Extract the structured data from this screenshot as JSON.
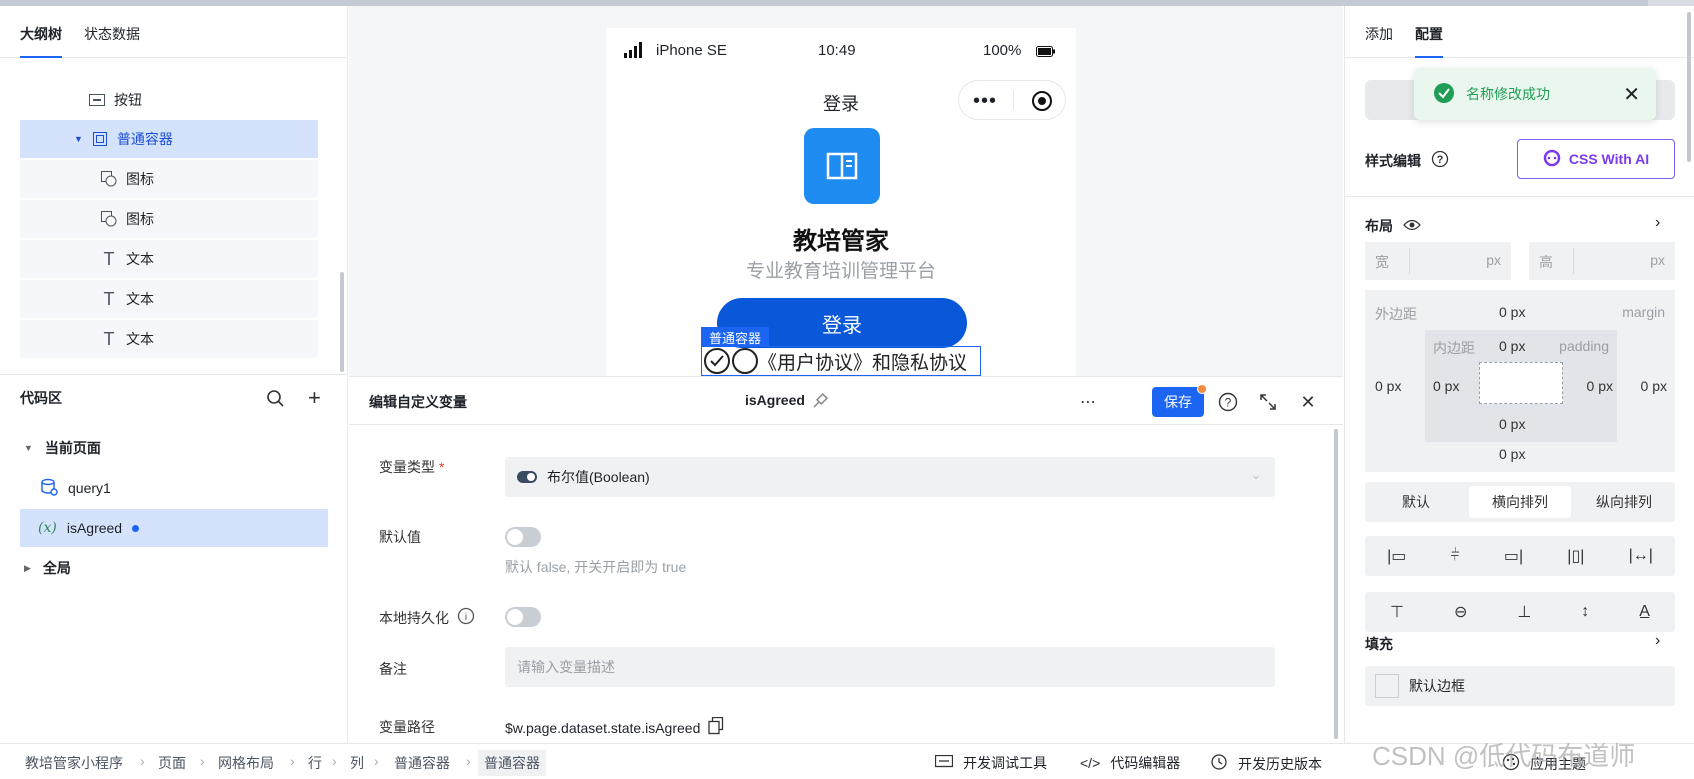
{
  "left_panel": {
    "tabs": [
      "大纲树",
      "状态数据"
    ],
    "tree": [
      {
        "label": "按钮",
        "icon": "button-icon"
      },
      {
        "label": "普通容器",
        "icon": "container-icon"
      },
      {
        "label": "图标",
        "icon": "icon-component-icon"
      },
      {
        "label": "图标",
        "icon": "icon-component-icon"
      },
      {
        "label": "文本",
        "icon": "text-icon"
      },
      {
        "label": "文本",
        "icon": "text-icon"
      },
      {
        "label": "文本",
        "icon": "text-icon"
      }
    ],
    "code_area": {
      "title": "代码区",
      "current_page": "当前页面",
      "items": [
        "query1",
        "isAgreed"
      ],
      "global": "全局"
    }
  },
  "preview": {
    "status_bar": {
      "device": "iPhone SE",
      "time": "10:49",
      "battery": "100%"
    },
    "nav_title": "登录",
    "app_name": "教培管家",
    "app_subtitle": "专业教育培训管理平台",
    "login_button": "登录",
    "selection_tag": "普通容器",
    "agreement_text": "《用户协议》和隐私协议"
  },
  "editor": {
    "title": "编辑自定义变量",
    "variable_name": "isAgreed",
    "save_label": "保存",
    "fields": {
      "type_label": "变量类型",
      "type_value": "布尔值(Boolean)",
      "default_label": "默认值",
      "default_hint": "默认 false, 开关开启即为 true",
      "persist_label": "本地持久化",
      "note_label": "备注",
      "note_placeholder": "请输入变量描述",
      "path_label": "变量路径",
      "path_value": "$w.page.dataset.state.isAgreed"
    }
  },
  "right_panel": {
    "tabs": [
      "添加",
      "配置"
    ],
    "style_edit": "样式编辑",
    "ai_button": "CSS With AI",
    "layout": "布局",
    "width_label": "宽",
    "height_label": "高",
    "unit": "px",
    "margin_label": "外边距",
    "margin_en": "margin",
    "padding_label": "内边距",
    "padding_en": "padding",
    "zero_px": "0 px",
    "direction_options": [
      "默认",
      "横向排列",
      "纵向排列"
    ],
    "fill": "填充",
    "default_border": "默认边框"
  },
  "toast": {
    "message": "名称修改成功"
  },
  "footer": {
    "breadcrumb": [
      "教培管家小程序",
      "页面",
      "网格布局",
      "行",
      "列",
      "普通容器",
      "普通容器"
    ],
    "tools": [
      "开发调试工具",
      "代码编辑器",
      "开发历史版本",
      "应用主题"
    ]
  },
  "watermark": "CSDN @低代码布道师"
}
